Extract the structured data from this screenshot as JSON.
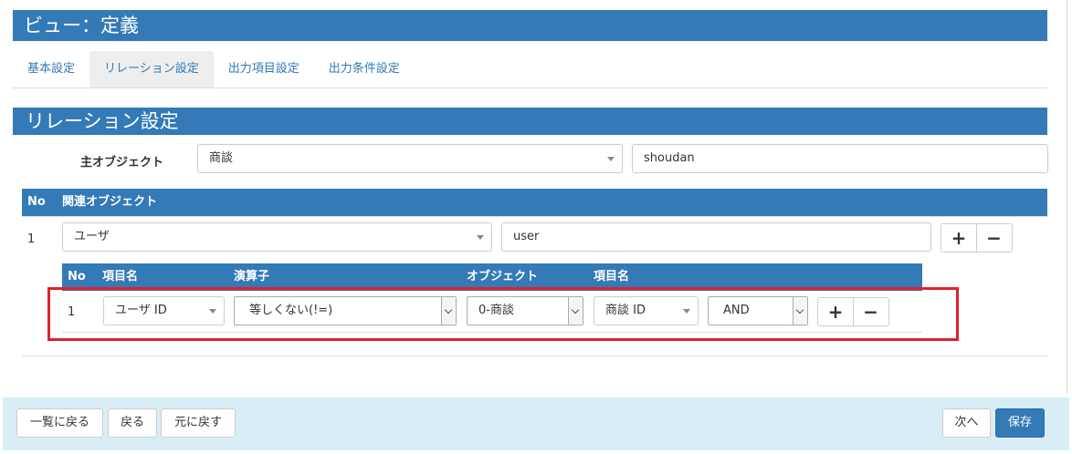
{
  "header": {
    "title": "ビュー：定義"
  },
  "tabs": [
    {
      "label": "基本設定"
    },
    {
      "label": "リレーション設定"
    },
    {
      "label": "出力項目設定"
    },
    {
      "label": "出力条件設定"
    }
  ],
  "section": {
    "title": "リレーション設定"
  },
  "main_object": {
    "label": "主オブジェクト",
    "selected": "商談",
    "alias": "shoudan"
  },
  "relation_table": {
    "headers": {
      "no": "No",
      "related_object": "関連オブジェクト"
    },
    "rows": [
      {
        "no": "1",
        "object": "ユーザ",
        "alias": "user"
      }
    ]
  },
  "condition_table": {
    "headers": {
      "no": "No",
      "item": "項目名",
      "operator": "演算子",
      "object": "オブジェクト",
      "target_item": "項目名"
    },
    "rows": [
      {
        "no": "1",
        "item": "ユーザ ID",
        "operator": "等しくない(!=)",
        "object": "0-商談",
        "target_item": "商談 ID",
        "logic": "AND"
      }
    ]
  },
  "buttons": {
    "plus": "+",
    "minus": "−"
  },
  "footer": {
    "back_to_list": "一覧に戻る",
    "back": "戻る",
    "revert": "元に戻す",
    "next": "次へ",
    "save": "保存"
  }
}
